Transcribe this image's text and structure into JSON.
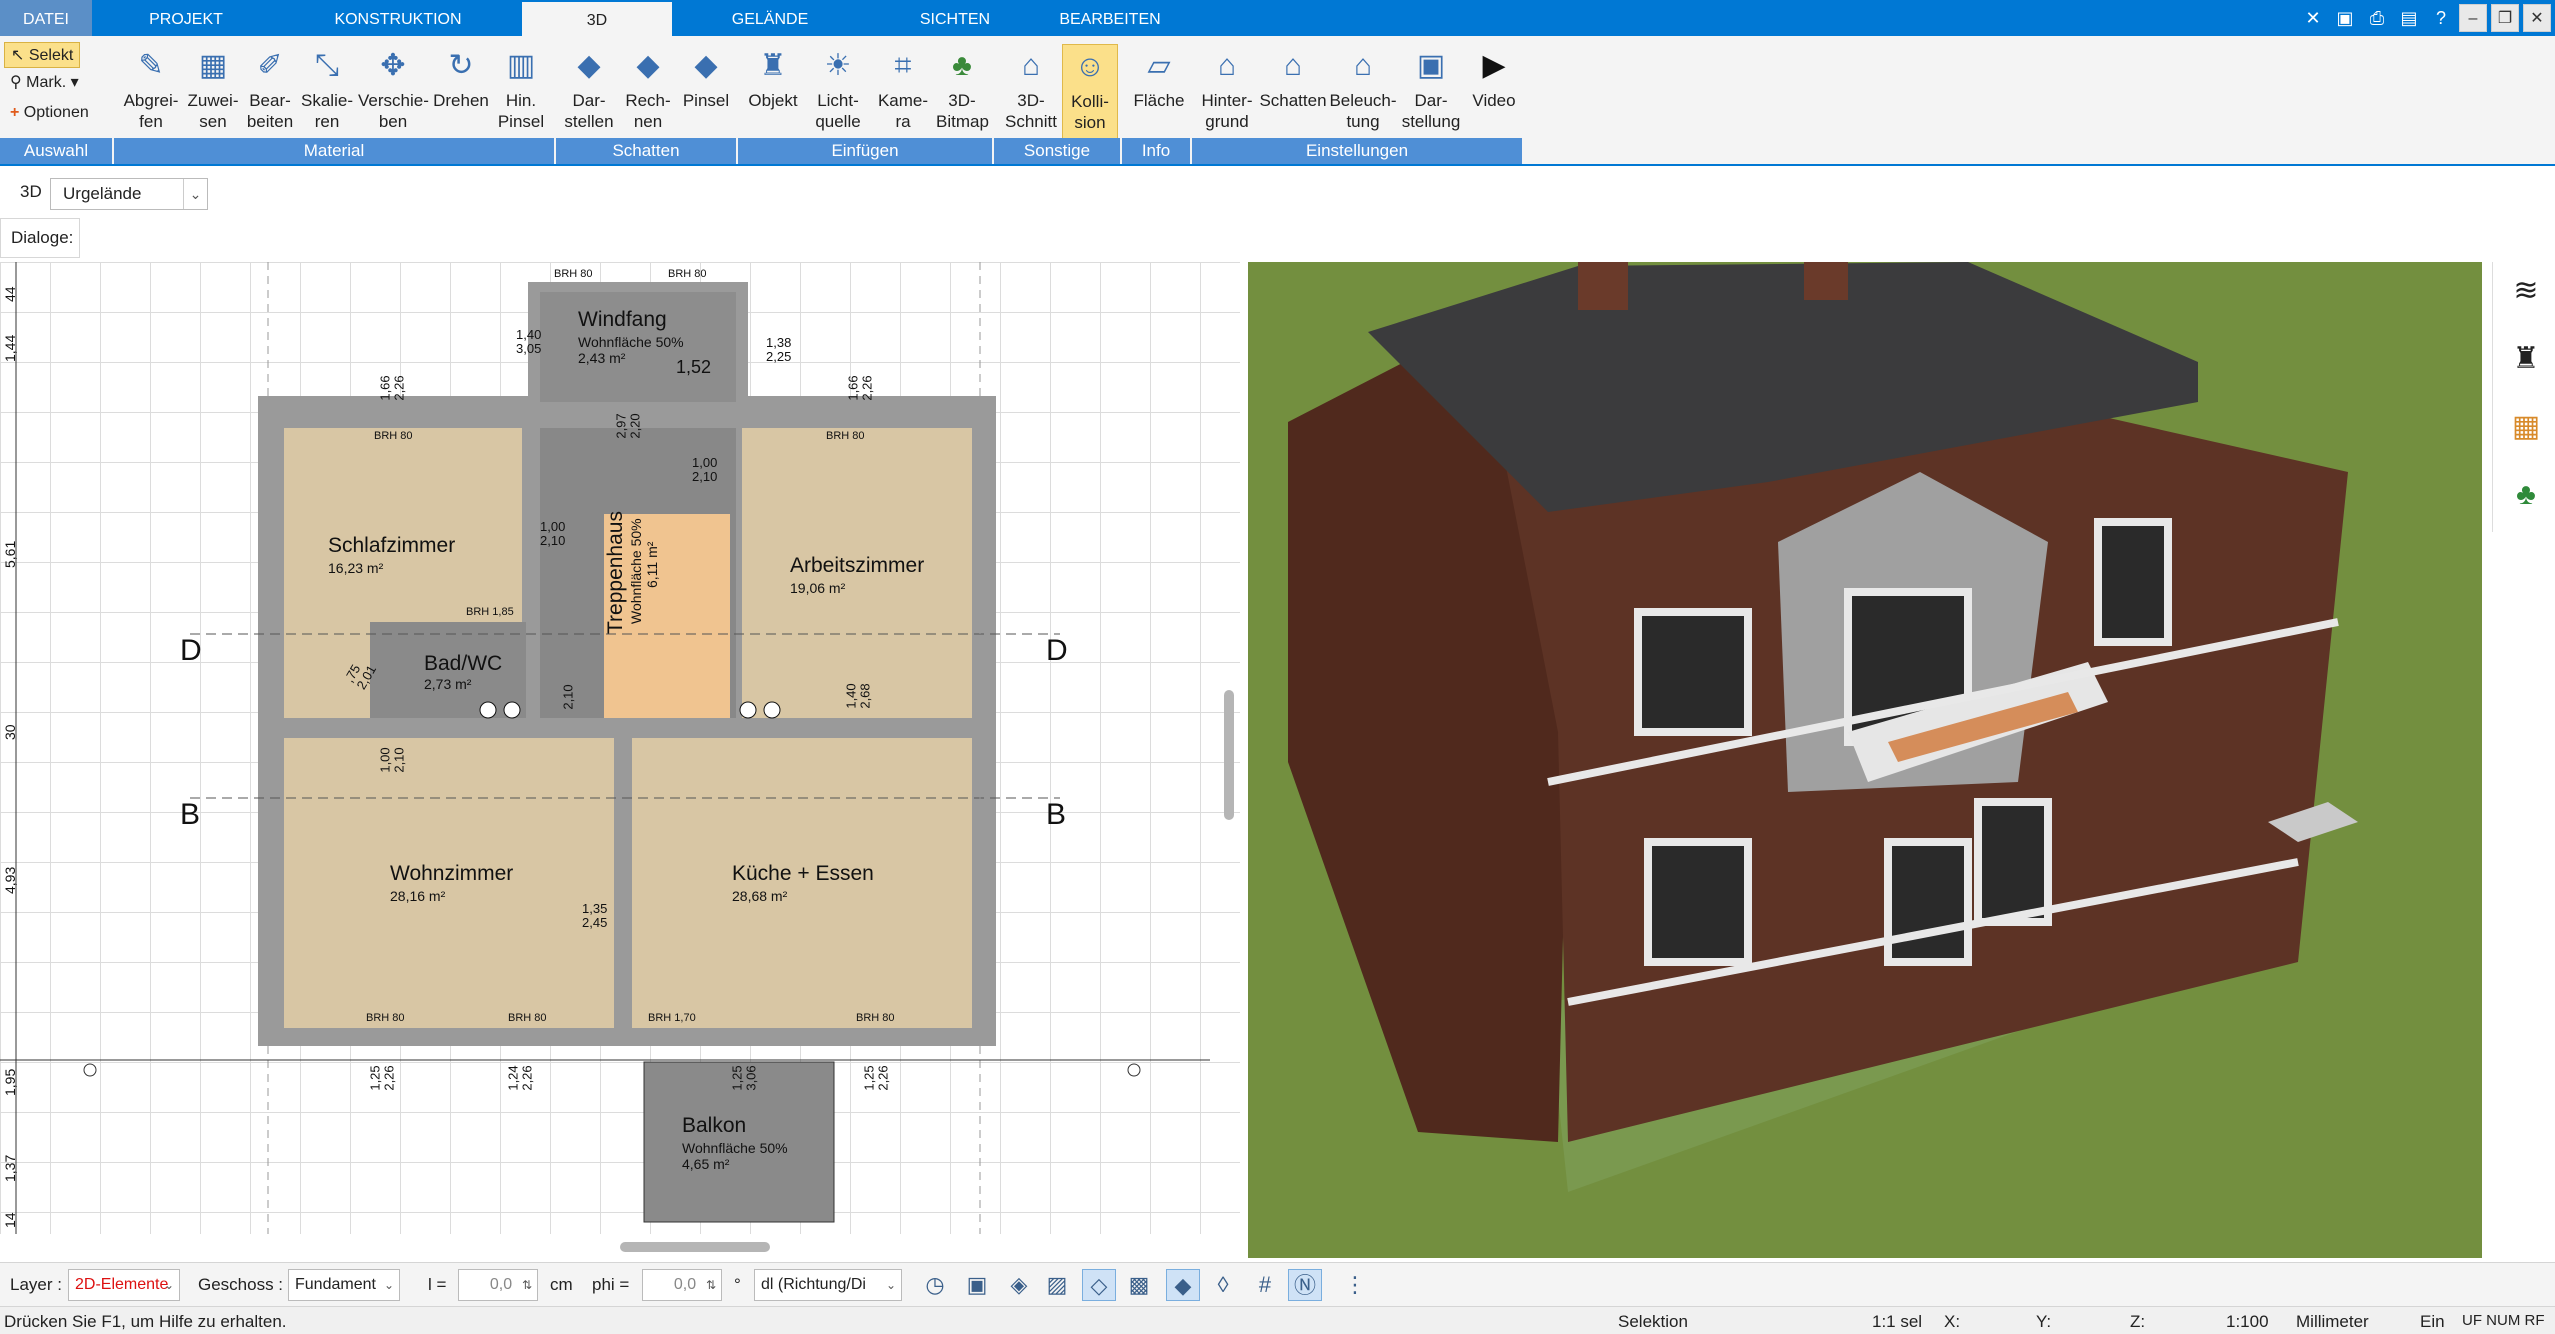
{
  "tabs": [
    "DATEI",
    "PROJEKT",
    "KONSTRUKTION",
    "3D",
    "GELÄNDE",
    "SICHTEN",
    "BEARBEITEN"
  ],
  "active_tab": "3D",
  "ribbon": {
    "auswahl": {
      "selekt": "Selekt",
      "mark": "Mark.",
      "optionen": "Optionen"
    },
    "buttons": [
      {
        "label": "Abgrei-\nfen",
        "icon": "eyedropper-icon"
      },
      {
        "label": "Zuwei-\nsen",
        "icon": "assign-icon"
      },
      {
        "label": "Bear-\nbeiten",
        "icon": "edit-icon"
      },
      {
        "label": "Skalie-\nren",
        "icon": "scale-icon"
      },
      {
        "label": "Verschie-\nben",
        "icon": "move-icon"
      },
      {
        "label": "Drehen",
        "icon": "rotate-icon"
      },
      {
        "label": "Hin.\nPinsel",
        "icon": "brush-icon"
      },
      {
        "label": "Dar-\nstellen",
        "icon": "shadow-display-icon"
      },
      {
        "label": "Rech-\nnen",
        "icon": "shadow-calc-icon"
      },
      {
        "label": "Pinsel",
        "icon": "shadow-brush-icon"
      },
      {
        "label": "Objekt",
        "icon": "chair-icon"
      },
      {
        "label": "Licht-\nquelle",
        "icon": "bulb-icon"
      },
      {
        "label": "Kame-\nra",
        "icon": "camera-icon"
      },
      {
        "label": "3D-\nBitmap",
        "icon": "tree-icon"
      },
      {
        "label": "3D-\nSchnitt",
        "icon": "section-icon"
      },
      {
        "label": "Kolli-\nsion",
        "icon": "collision-icon"
      },
      {
        "label": "Fläche",
        "icon": "area-icon"
      },
      {
        "label": "Hinter-\ngrund",
        "icon": "background-icon"
      },
      {
        "label": "Schatten",
        "icon": "house-shadow-icon"
      },
      {
        "label": "Beleuch-\ntung",
        "icon": "lighting-icon"
      },
      {
        "label": "Dar-\nstellung",
        "icon": "display-icon"
      },
      {
        "label": "Video",
        "icon": "play-icon"
      }
    ],
    "groups": [
      "Auswahl",
      "Material",
      "Schatten",
      "Einfügen",
      "Sonstige",
      "Info",
      "Einstellungen"
    ]
  },
  "view_row": {
    "label": "3D",
    "selected": "Urgelände"
  },
  "dialogs_label": "Dialoge:",
  "plan": {
    "rooms": [
      {
        "name": "Windfang",
        "area": "Wohnfläche 50%",
        "area2": "2,43 m²"
      },
      {
        "name": "Schlafzimmer",
        "area": "16,23 m²"
      },
      {
        "name": "Treppenhaus",
        "area": "Wohnfläche 50%",
        "area2": "6,11 m²"
      },
      {
        "name": "Arbeitszimmer",
        "area": "19,06 m²"
      },
      {
        "name": "Bad/WC",
        "area": "2,73 m²"
      },
      {
        "name": "Wohnzimmer",
        "area": "28,16 m²"
      },
      {
        "name": "Küche + Essen",
        "area": "28,68 m²"
      },
      {
        "name": "Balkon",
        "area": "Wohnfläche 50%",
        "area2": "4,65 m²"
      }
    ],
    "sections": [
      "D",
      "D",
      "B",
      "B"
    ],
    "dims": [
      "1,40\n3,05",
      "1,38\n2,25",
      "1,52",
      "1,00\n2,10",
      "1,00\n2,10",
      "1,00\n2,10",
      "1,35\n2,45",
      "1,40\n2,68",
      "1,66\n2,26",
      "1,66\n2,26",
      "1,25\n2,26",
      "1,24\n2,26",
      "1,25\n3,06",
      "1,25\n2,26",
      ",75\n2,01",
      "2,97\n2,20",
      "2,10"
    ],
    "brh": [
      "BRH 80",
      "BRH 80",
      "BRH 80",
      "BRH 80",
      "BRH 1,85",
      "BRH 80",
      "BRH 80",
      "BRH 1,70",
      "BRH 80"
    ],
    "ruler": [
      "44",
      "1,44",
      "5,61",
      "30",
      "4,93",
      "1,95",
      "1,37",
      "14"
    ]
  },
  "bottombar": {
    "layer_label": "Layer :",
    "layer_value": "2D-Elemente",
    "geschoss_label": "Geschoss :",
    "geschoss_value": "Fundament",
    "l_label": "l =",
    "l_value": "0,0",
    "l_unit": "cm",
    "phi_label": "phi =",
    "phi_value": "0,0",
    "phi_unit": "°",
    "direction_value": "dl (Richtung/Di"
  },
  "statusbar": {
    "help": "Drücken Sie F1, um Hilfe zu erhalten.",
    "mode": "Selektion",
    "sel": "1:1 sel",
    "x": "X:",
    "y": "Y:",
    "z": "Z:",
    "scale": "1:100",
    "unit": "Millimeter",
    "ein": "Ein",
    "flags": "UF  NUM  RF"
  },
  "colors": {
    "accent": "#0078d4",
    "group_bar": "#4f8fd6",
    "highlight": "#fbe08a",
    "grass": "#6f8b3b",
    "brick": "#5a3224",
    "roof": "#3b3b3d"
  }
}
